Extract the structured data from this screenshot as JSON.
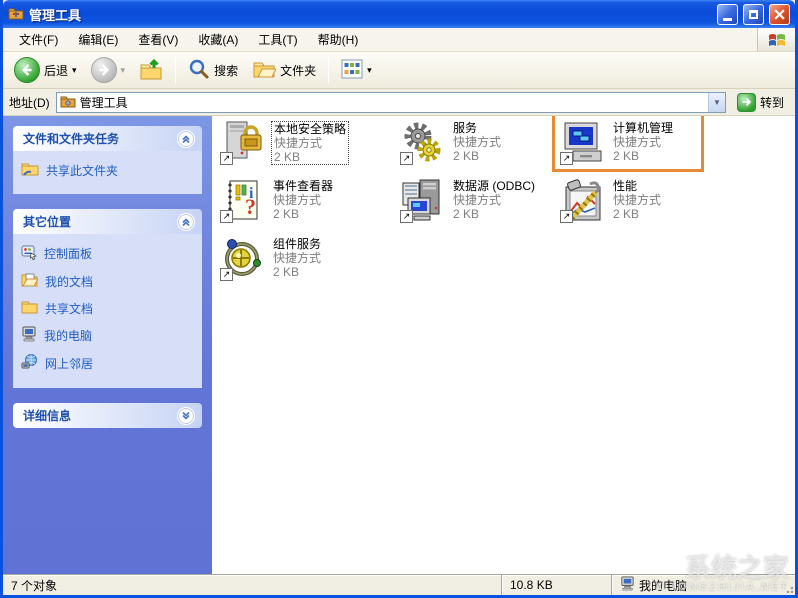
{
  "window": {
    "title": "管理工具"
  },
  "menu_bar": {
    "items": [
      {
        "label": "文件(F)"
      },
      {
        "label": "编辑(E)"
      },
      {
        "label": "查看(V)"
      },
      {
        "label": "收藏(A)"
      },
      {
        "label": "工具(T)"
      },
      {
        "label": "帮助(H)"
      }
    ]
  },
  "toolbar": {
    "back_label": "后退",
    "search_label": "搜索",
    "folders_label": "文件夹"
  },
  "address_bar": {
    "label": "地址(D)",
    "value": "管理工具",
    "go_label": "转到"
  },
  "sidebar": {
    "panels": [
      {
        "title": "文件和文件夹任务",
        "state": "expanded",
        "items": [
          {
            "label": "共享此文件夹",
            "icon": "share-folder-icon"
          }
        ]
      },
      {
        "title": "其它位置",
        "state": "expanded",
        "items": [
          {
            "label": "控制面板",
            "icon": "control-panel-icon"
          },
          {
            "label": "我的文档",
            "icon": "my-documents-icon"
          },
          {
            "label": "共享文档",
            "icon": "shared-documents-icon"
          },
          {
            "label": "我的电脑",
            "icon": "my-computer-icon"
          },
          {
            "label": "网上邻居",
            "icon": "network-places-icon"
          }
        ]
      },
      {
        "title": "详细信息",
        "state": "collapsed",
        "items": []
      }
    ]
  },
  "content": {
    "items": [
      {
        "name": "本地安全策略",
        "type": "快捷方式",
        "size": "2 KB",
        "selected": true
      },
      {
        "name": "服务",
        "type": "快捷方式",
        "size": "2 KB"
      },
      {
        "name": "计算机管理",
        "type": "快捷方式",
        "size": "2 KB",
        "highlighted": true
      },
      {
        "name": "事件查看器",
        "type": "快捷方式",
        "size": "2 KB"
      },
      {
        "name": "数据源 (ODBC)",
        "type": "快捷方式",
        "size": "2 KB"
      },
      {
        "name": "性能",
        "type": "快捷方式",
        "size": "2 KB"
      },
      {
        "name": "组件服务",
        "type": "快捷方式",
        "size": "2 KB"
      }
    ]
  },
  "status_bar": {
    "objects": "7 个对象",
    "size": "10.8 KB",
    "zone": "我的电脑"
  },
  "watermark": {
    "line1": "系统之家",
    "line2": "XITONGZHIJIA.NET"
  },
  "icons": {
    "caret_down": "▾",
    "combo_arrow": "▼",
    "shortcut_arrow": "↗"
  },
  "colors": {
    "highlight_box": "#E78A33",
    "titlebar_blue": "#0B4BD8",
    "taskpane_blue": "#6375D6",
    "link_blue": "#215DC6",
    "selection_orange": "#E78A33"
  }
}
